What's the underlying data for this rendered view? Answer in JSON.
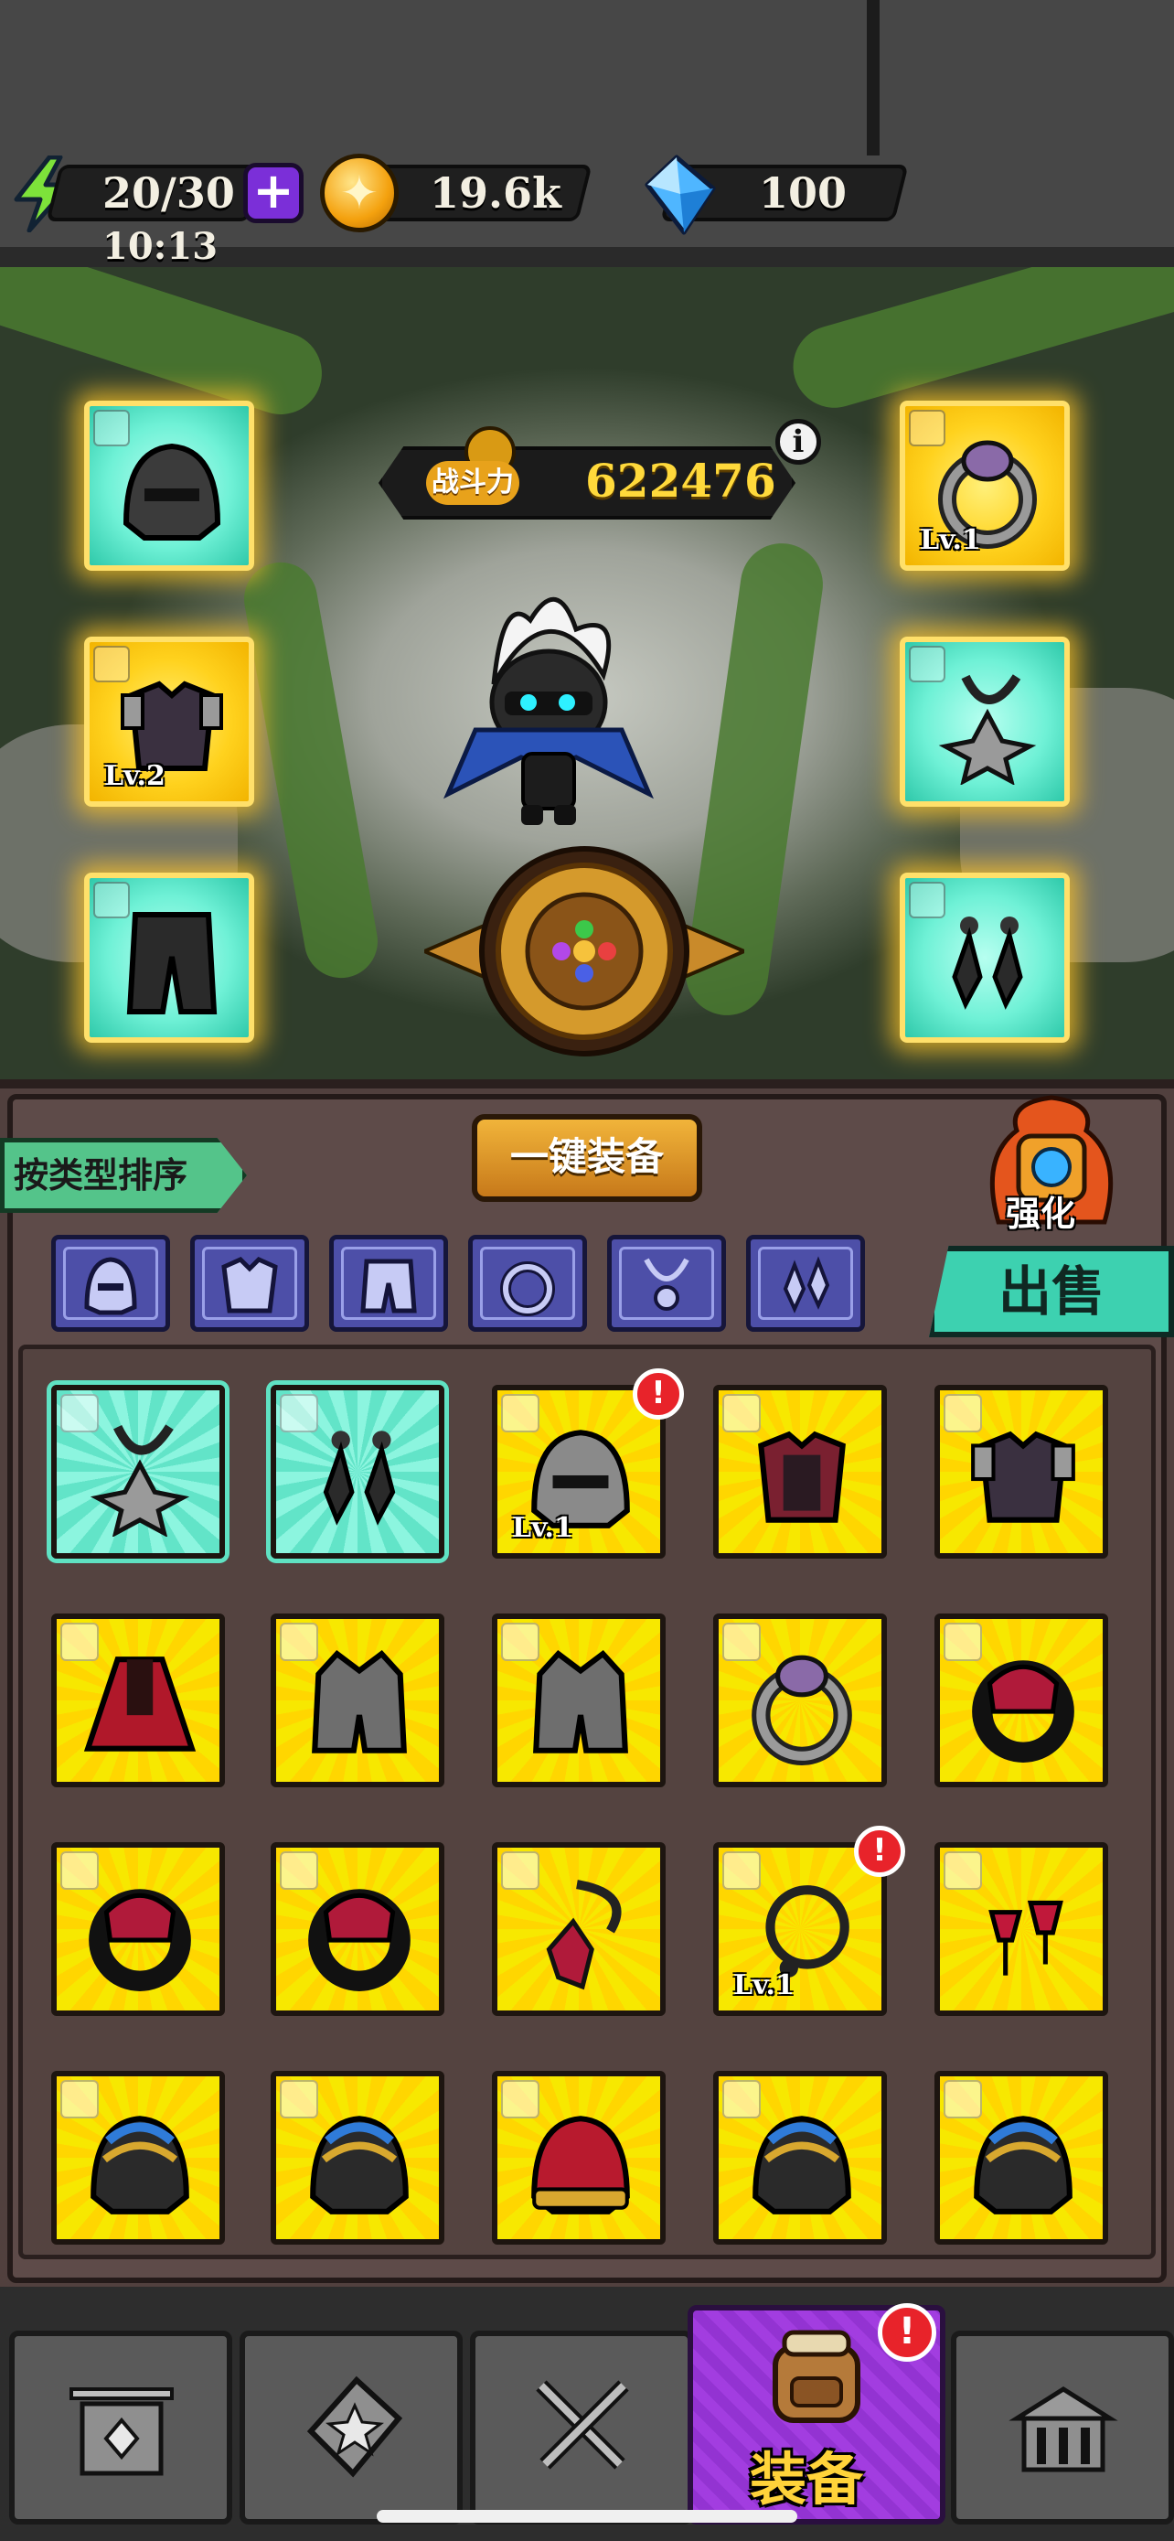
{
  "status": {
    "energy": "20/30",
    "energy_timer": "10:13",
    "gold": "19.6k",
    "gems": "100"
  },
  "hero": {
    "power_label": "战斗力",
    "power_value": "622476"
  },
  "equipped": [
    {
      "slot": "helmet",
      "icon": "helmet-icon",
      "rarity": "teal",
      "level": ""
    },
    {
      "slot": "ring",
      "icon": "ring-icon",
      "rarity": "gold",
      "level": "Lv.1"
    },
    {
      "slot": "armor",
      "icon": "armor-icon",
      "rarity": "gold",
      "level": "Lv.2"
    },
    {
      "slot": "necklace",
      "icon": "necklace-icon",
      "rarity": "teal",
      "level": ""
    },
    {
      "slot": "pants",
      "icon": "pants-icon",
      "rarity": "teal",
      "level": ""
    },
    {
      "slot": "earrings",
      "icon": "earrings-icon",
      "rarity": "teal",
      "level": ""
    }
  ],
  "toolbar": {
    "sort_label": "按类型排序",
    "equip_all_label": "一键装备",
    "upgrade_label": "强化",
    "sell_label": "出售"
  },
  "filters": [
    "helmet-filter",
    "armor-filter",
    "pants-filter",
    "ring-filter",
    "necklace-filter",
    "earrings-filter"
  ],
  "inventory": [
    {
      "icon": "necklace-icon",
      "rarity": "teal",
      "level": "",
      "alert": false
    },
    {
      "icon": "earrings-icon",
      "rarity": "teal",
      "level": "",
      "alert": false
    },
    {
      "icon": "helmet-icon",
      "rarity": "gold",
      "level": "Lv.1",
      "alert": true
    },
    {
      "icon": "armor-icon",
      "rarity": "gold",
      "level": "",
      "alert": false
    },
    {
      "icon": "armor-icon",
      "rarity": "gold",
      "level": "",
      "alert": false
    },
    {
      "icon": "pants-icon",
      "rarity": "gold",
      "level": "",
      "alert": false
    },
    {
      "icon": "pants-icon",
      "rarity": "gold",
      "level": "",
      "alert": false
    },
    {
      "icon": "pants-icon",
      "rarity": "gold",
      "level": "",
      "alert": false
    },
    {
      "icon": "ring-icon",
      "rarity": "gold",
      "level": "",
      "alert": false
    },
    {
      "icon": "ring-icon",
      "rarity": "gold",
      "level": "",
      "alert": false
    },
    {
      "icon": "ring-icon",
      "rarity": "gold",
      "level": "",
      "alert": false
    },
    {
      "icon": "ring-icon",
      "rarity": "gold",
      "level": "",
      "alert": false
    },
    {
      "icon": "necklace-icon",
      "rarity": "gold",
      "level": "",
      "alert": false
    },
    {
      "icon": "necklace-icon",
      "rarity": "gold",
      "level": "Lv.1",
      "alert": true
    },
    {
      "icon": "earrings-icon",
      "rarity": "gold",
      "level": "",
      "alert": false
    },
    {
      "icon": "helmet-icon",
      "rarity": "gold",
      "level": "",
      "alert": false
    },
    {
      "icon": "helmet-icon",
      "rarity": "gold",
      "level": "",
      "alert": false
    },
    {
      "icon": "helmet-icon",
      "rarity": "gold",
      "level": "",
      "alert": false
    },
    {
      "icon": "helmet-icon",
      "rarity": "gold",
      "level": "",
      "alert": false
    },
    {
      "icon": "helmet-icon",
      "rarity": "gold",
      "level": "",
      "alert": false
    }
  ],
  "nav": {
    "tabs": [
      "shop-tab",
      "cards-tab",
      "battle-tab",
      "equipment-tab",
      "castle-tab"
    ],
    "active_label": "装备"
  },
  "colors": {
    "gold_card": "#ffd600",
    "teal_card": "#62e4c8",
    "filter_button": "#4d4fa8",
    "sell_button": "#3dd1b0",
    "active_tab": "#a23de0"
  }
}
